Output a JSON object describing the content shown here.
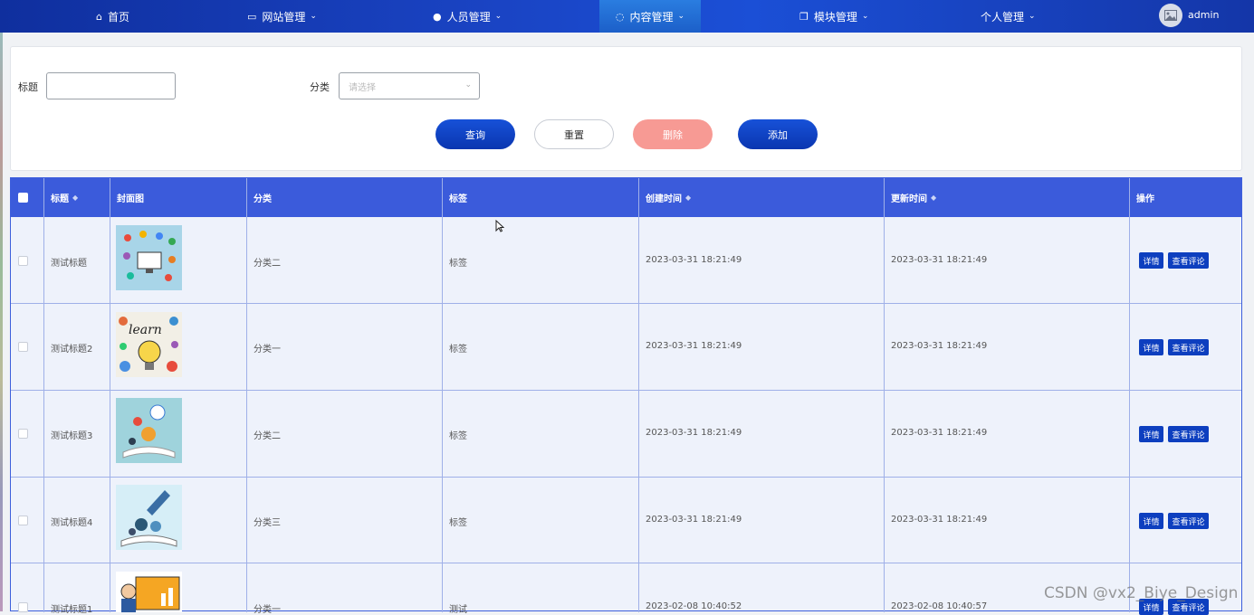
{
  "nav": {
    "items": [
      {
        "label": "首页",
        "icon": "home-icon"
      },
      {
        "label": "网站管理",
        "icon": "monitor-icon"
      },
      {
        "label": "人员管理",
        "icon": "user-icon"
      },
      {
        "label": "内容管理",
        "icon": "chat-icon",
        "active": true
      },
      {
        "label": "模块管理",
        "icon": "copy-icon"
      },
      {
        "label": "个人管理",
        "icon": ""
      }
    ],
    "user": "admin"
  },
  "search": {
    "title_label": "标题",
    "title_value": "",
    "category_label": "分类",
    "category_placeholder": "请选择",
    "buttons": {
      "query": "查询",
      "reset": "重置",
      "delete": "删除",
      "add": "添加"
    }
  },
  "table": {
    "columns": [
      "标题",
      "封面图",
      "分类",
      "标签",
      "创建时间",
      "更新时间",
      "操作"
    ],
    "rows": [
      {
        "title": "测试标题",
        "category": "分类二",
        "tag": "标签",
        "created": "2023-03-31 18:21:49",
        "updated": "2023-03-31 18:21:49"
      },
      {
        "title": "测试标题2",
        "category": "分类一",
        "tag": "标签",
        "created": "2023-03-31 18:21:49",
        "updated": "2023-03-31 18:21:49"
      },
      {
        "title": "测试标题3",
        "category": "分类二",
        "tag": "标签",
        "created": "2023-03-31 18:21:49",
        "updated": "2023-03-31 18:21:49"
      },
      {
        "title": "测试标题4",
        "category": "分类三",
        "tag": "标签",
        "created": "2023-03-31 18:21:49",
        "updated": "2023-03-31 18:21:49"
      },
      {
        "title": "测试标题1",
        "category": "分类一",
        "tag": "测试",
        "created": "2023-02-08 10:40:52",
        "updated": "2023-02-08 10:40:57"
      }
    ],
    "actions": {
      "detail": "详情",
      "comments": "查看评论"
    }
  },
  "watermark": "CSDN @vx2_Biye_Design"
}
